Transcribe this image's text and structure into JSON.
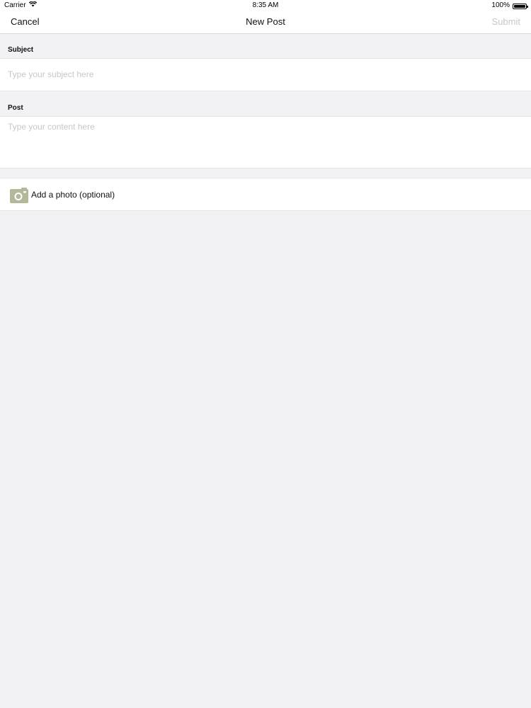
{
  "status_bar": {
    "carrier": "Carrier",
    "time": "8:35 AM",
    "battery": "100%"
  },
  "nav": {
    "cancel_label": "Cancel",
    "title": "New Post",
    "submit_label": "Submit"
  },
  "form": {
    "subject": {
      "label": "Subject",
      "placeholder": "Type your subject here",
      "value": ""
    },
    "post": {
      "label": "Post",
      "placeholder": "Type your content here",
      "value": ""
    },
    "photo": {
      "label": "Add a photo (optional)",
      "icon": "camera-icon"
    }
  },
  "colors": {
    "background": "#f2f1f4",
    "placeholder": "#c7c7cc",
    "submit_disabled": "#c7c7cc",
    "camera_icon": "#b3b89a"
  }
}
